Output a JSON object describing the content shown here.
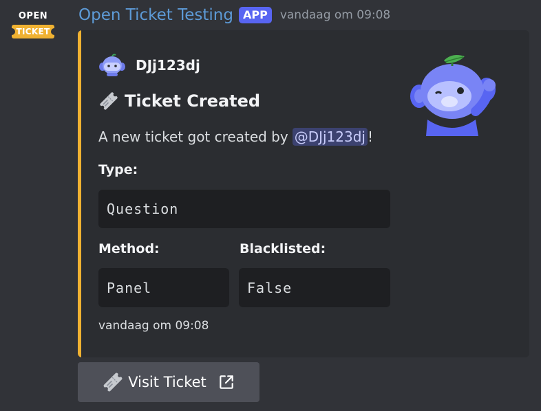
{
  "message": {
    "avatar": {
      "line1": "OPEN",
      "line2": "TICKET"
    },
    "author_name": "Open Ticket Testing",
    "badge": "APP",
    "timestamp": "vandaag om 09:08"
  },
  "embed": {
    "accent_color": "#f0b232",
    "author": {
      "name": "DJj123dj",
      "icon": "discord-wumpus-icon"
    },
    "title": {
      "icon": "ticket-emoji-icon",
      "text": "Ticket Created"
    },
    "description": {
      "prefix": "A new ticket got created by",
      "mention": "@DJj123dj",
      "suffix": "!"
    },
    "fields": [
      {
        "name": "Type:",
        "value": "Question"
      },
      {
        "name": "Method:",
        "value": "Panel"
      },
      {
        "name": "Blacklisted:",
        "value": "False"
      }
    ],
    "footer": "vandaag om 09:08",
    "thumbnail": "wumpus-with-leaf-thumbnail"
  },
  "button": {
    "icon": "ticket-emoji-icon",
    "label": "Visit Ticket",
    "trailing_icon": "external-link-icon"
  },
  "colors": {
    "background": "#313338",
    "embed_background": "#2b2d31",
    "username": "#5d9ad6",
    "badge": "#5865f2",
    "mention_bg": "#3c4270",
    "button_bg": "#4e5058"
  }
}
